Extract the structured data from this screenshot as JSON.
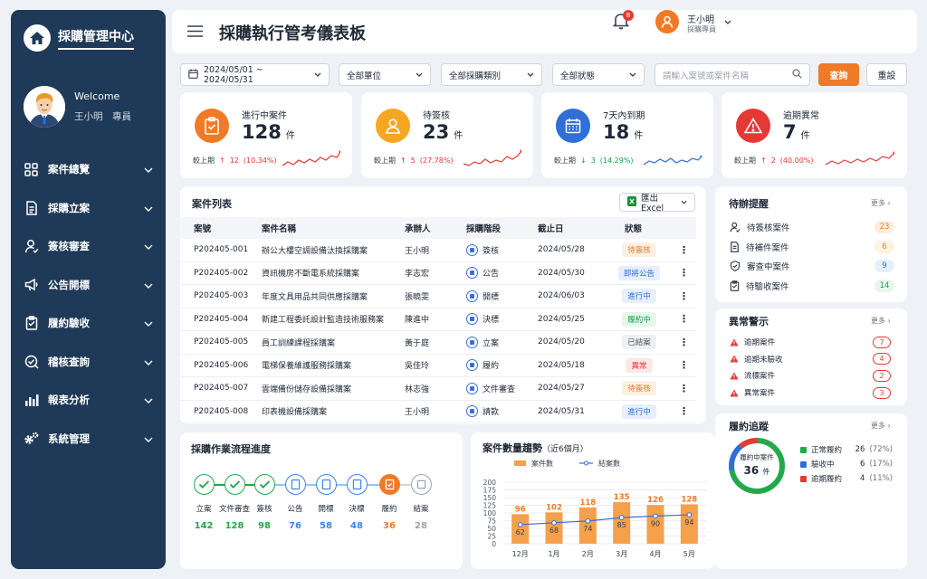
{
  "brand": {
    "title": "採購管理中心"
  },
  "profile": {
    "welcome": "Welcome",
    "name": "王小明　專員"
  },
  "nav": [
    {
      "label": "案件總覽",
      "icon": "grid-icon"
    },
    {
      "label": "採購立案",
      "icon": "document-icon"
    },
    {
      "label": "簽核審查",
      "icon": "user-check-icon"
    },
    {
      "label": "公告開標",
      "icon": "megaphone-icon"
    },
    {
      "label": "履約驗收",
      "icon": "clipboard-icon"
    },
    {
      "label": "稽核查詢",
      "icon": "check-circle-icon"
    },
    {
      "label": "報表分析",
      "icon": "bar-chart-icon"
    },
    {
      "label": "系統管理",
      "icon": "gears-icon"
    }
  ],
  "header": {
    "title": "採購執行管考儀表板",
    "notifications": "8",
    "user_name": "王小明",
    "user_role": "採購專員"
  },
  "filters": {
    "date_range": "2024/05/01 ~ 2024/05/31",
    "unit": "全部單位",
    "category": "全部採購類別",
    "status": "全部狀態",
    "search_placeholder": "請輸入案號或案件名稱",
    "query_label": "查詢",
    "reset_label": "重設"
  },
  "colors": {
    "accent": "#f07a25",
    "sidebar": "#1f3a58",
    "up": "#e53935",
    "down": "#16a34a",
    "progress_blue": "#3b82f6"
  },
  "stats": [
    {
      "label": "進行中案件",
      "value": "128",
      "unit": "件",
      "comp_label": "較上期",
      "arrow": "↑",
      "delta": "12",
      "pct": "(10.34%)",
      "dir": "up",
      "color": "#f07a25",
      "icon": "clipboard-icon"
    },
    {
      "label": "待簽核",
      "value": "23",
      "unit": "件",
      "comp_label": "較上期",
      "arrow": "↑",
      "delta": "5",
      "pct": "(27.78%)",
      "dir": "up",
      "color": "#f5a623",
      "icon": "user-icon"
    },
    {
      "label": "7天內到期",
      "value": "18",
      "unit": "件",
      "comp_label": "較上期",
      "arrow": "↓",
      "delta": "3",
      "pct": "(14.29%)",
      "dir": "down",
      "color": "#2f6fd6",
      "icon": "calendar-icon"
    },
    {
      "label": "逾期異常",
      "value": "7",
      "unit": "件",
      "comp_label": "較上期",
      "arrow": "↑",
      "delta": "2",
      "pct": "(40.00%)",
      "dir": "up",
      "color": "#e53935",
      "icon": "warning-icon"
    }
  ],
  "case_list": {
    "title": "案件列表",
    "export_label": "匯出 Excel",
    "columns": [
      "案號",
      "案件名稱",
      "承辦人",
      "採購階段",
      "截止日",
      "狀態"
    ],
    "rows": [
      {
        "id": "P202405-001",
        "name": "辦公大樓空調設備汰換採購案",
        "owner": "王小明",
        "stage": "簽核",
        "due": "2024/05/28",
        "status": "待簽核",
        "status_color": "#e67e22",
        "status_bg": "#fdf0e3"
      },
      {
        "id": "P202405-002",
        "name": "資訊機房不斷電系統採購案",
        "owner": "李志宏",
        "stage": "公告",
        "due": "2024/05/30",
        "status": "即將公告",
        "status_color": "#2f6fd6",
        "status_bg": "#e6effc"
      },
      {
        "id": "P202405-003",
        "name": "年度文具用品共同供應採購案",
        "owner": "張曉雯",
        "stage": "開標",
        "due": "2024/06/03",
        "status": "進行中",
        "status_color": "#2f6fd6",
        "status_bg": "#e6effc"
      },
      {
        "id": "P202405-004",
        "name": "新建工程委託設計監造技術服務案",
        "owner": "陳進中",
        "stage": "決標",
        "due": "2024/05/25",
        "status": "履約中",
        "status_color": "#16a34a",
        "status_bg": "#e5f6ea"
      },
      {
        "id": "P202405-005",
        "name": "員工訓練課程採購案",
        "owner": "黃于庭",
        "stage": "立案",
        "due": "2024/05/20",
        "status": "已結案",
        "status_color": "#4b5563",
        "status_bg": "#eef0f3"
      },
      {
        "id": "P202405-006",
        "name": "電梯保養維護服務採購案",
        "owner": "吳佳玲",
        "stage": "履約",
        "due": "2024/05/18",
        "status": "異常",
        "status_color": "#e53935",
        "status_bg": "#fde8e8"
      },
      {
        "id": "P202405-007",
        "name": "雲端備份儲存設備採購案",
        "owner": "林志強",
        "stage": "文件審查",
        "due": "2024/05/27",
        "status": "待簽核",
        "status_color": "#e67e22",
        "status_bg": "#fdf0e3"
      },
      {
        "id": "P202405-008",
        "name": "印表機設備採購案",
        "owner": "王小明",
        "stage": "請款",
        "due": "2024/05/31",
        "status": "進行中",
        "status_color": "#2f6fd6",
        "status_bg": "#e6effc"
      }
    ]
  },
  "todo": {
    "title": "待辦提醒",
    "more": "更多",
    "items": [
      {
        "label": "待簽核案件",
        "count": "23",
        "color": "#e67e22",
        "bg": "#fdece0",
        "icon": "user-check-icon"
      },
      {
        "label": "待補件案件",
        "count": "6",
        "color": "#e67e22",
        "bg": "#fdf3e2",
        "icon": "document-icon"
      },
      {
        "label": "審查中案件",
        "count": "9",
        "color": "#2f6fd6",
        "bg": "#e6effc",
        "icon": "shield-check-icon"
      },
      {
        "label": "待驗收案件",
        "count": "14",
        "color": "#16a34a",
        "bg": "#e5f6ea",
        "icon": "clipboard-check-icon"
      }
    ]
  },
  "alerts": {
    "title": "異常警示",
    "more": "更多",
    "items": [
      {
        "label": "逾期案件",
        "count": "7"
      },
      {
        "label": "逾期未驗收",
        "count": "4"
      },
      {
        "label": "流標案件",
        "count": "2"
      },
      {
        "label": "異常案件",
        "count": "3"
      }
    ]
  },
  "flow": {
    "title": "採購作業流程進度",
    "steps": [
      {
        "label": "立案",
        "count": "142",
        "state": "done"
      },
      {
        "label": "文件審查",
        "count": "128",
        "state": "done"
      },
      {
        "label": "簽核",
        "count": "98",
        "state": "done"
      },
      {
        "label": "公告",
        "count": "76",
        "state": "progress"
      },
      {
        "label": "開標",
        "count": "58",
        "state": "progress"
      },
      {
        "label": "決標",
        "count": "48",
        "state": "progress"
      },
      {
        "label": "履約",
        "count": "36",
        "state": "current"
      },
      {
        "label": "結案",
        "count": "28",
        "state": "pending"
      }
    ]
  },
  "trend": {
    "title": "案件數量趨勢",
    "subtitle": "（近6個月）"
  },
  "chart_data": {
    "type": "bar",
    "categories": [
      "12月",
      "1月",
      "2月",
      "3月",
      "4月",
      "5月"
    ],
    "series": [
      {
        "name": "案件數",
        "type": "bar",
        "values": [
          96,
          102,
          118,
          135,
          126,
          128
        ],
        "color": "#f5a04a"
      },
      {
        "name": "結案數",
        "type": "line",
        "values": [
          62,
          68,
          74,
          85,
          90,
          94
        ],
        "color": "#3b6fd8"
      }
    ],
    "ylim": [
      0,
      200
    ],
    "yticks": [
      0,
      25,
      50,
      75,
      100,
      125,
      150,
      175,
      200
    ],
    "legend": "top-left"
  },
  "tracking": {
    "title": "履約追蹤",
    "more": "更多",
    "center_label": "履約中案件",
    "center_value": "36",
    "center_unit": "件",
    "items": [
      {
        "label": "正常履約",
        "value": "26",
        "pct": "(72%)",
        "color": "#22a94a",
        "fraction": 0.72
      },
      {
        "label": "驗收中",
        "value": "6",
        "pct": "(17%)",
        "color": "#2f6fd6",
        "fraction": 0.17
      },
      {
        "label": "逾期履約",
        "value": "4",
        "pct": "(11%)",
        "color": "#e53935",
        "fraction": 0.11
      }
    ]
  }
}
